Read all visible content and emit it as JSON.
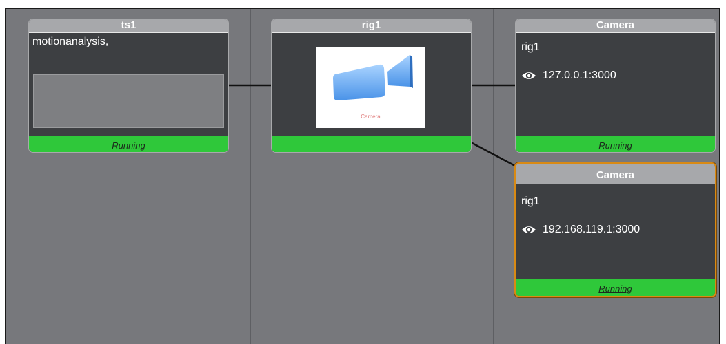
{
  "nodes": {
    "ts1": {
      "title": "ts1",
      "text": "motionanalysis,",
      "status": "Running"
    },
    "rig1": {
      "title": "rig1",
      "thumbnail_caption": "Camera",
      "status": ""
    },
    "camera_top": {
      "title": "Camera",
      "rig": "rig1",
      "address": "127.0.0.1:3000",
      "status": "Running"
    },
    "camera_bottom": {
      "title": "Camera",
      "rig": "rig1",
      "address": "192.168.119.1:3000",
      "status": "Running"
    }
  },
  "colors": {
    "canvas": "#77787c",
    "node_body": "#3d3f42",
    "node_header": "#a7a8ab",
    "status_running": "#2fc83a",
    "selection": "#d98a14"
  },
  "icons": {
    "visibility": "eye-icon"
  }
}
